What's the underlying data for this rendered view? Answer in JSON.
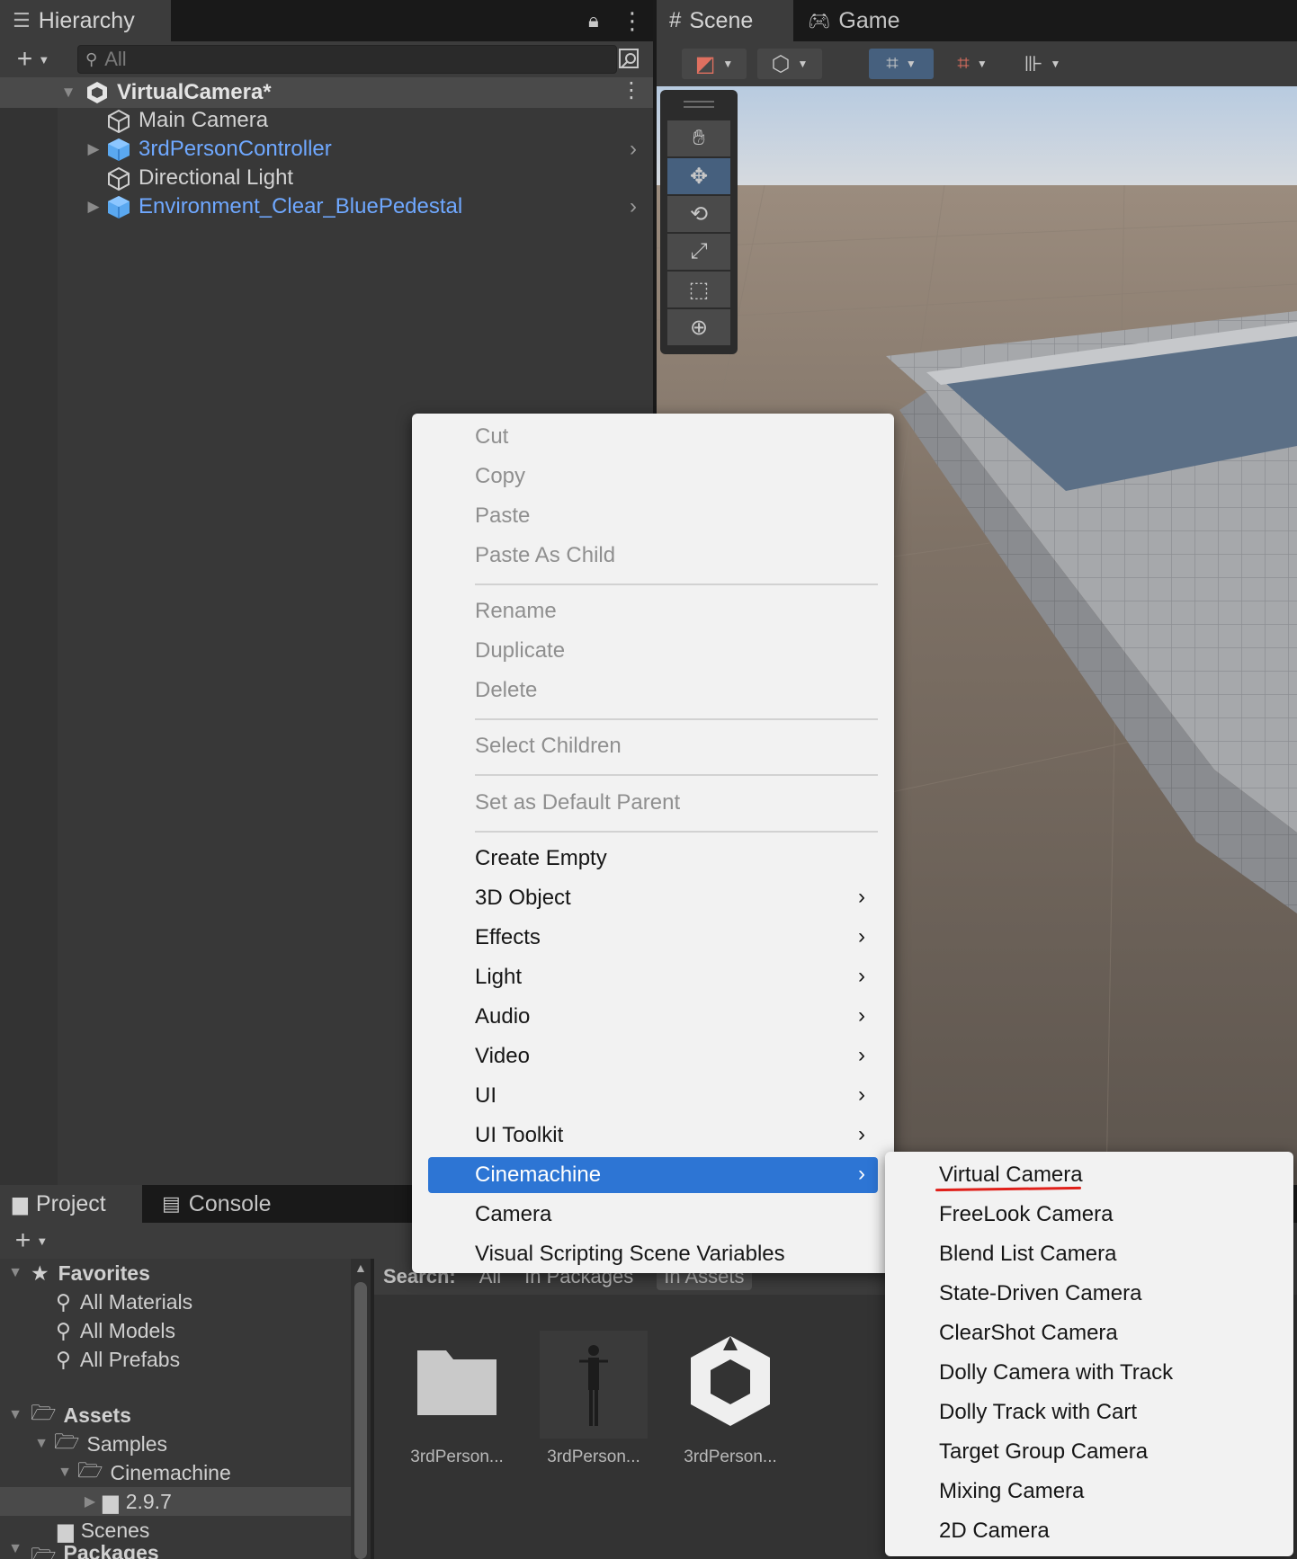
{
  "hierarchy": {
    "tab_label": "Hierarchy",
    "search_placeholder": "All",
    "scene_name": "VirtualCamera*",
    "items": [
      {
        "label": "Main Camera"
      },
      {
        "label": "3rdPersonController"
      },
      {
        "label": "Directional Light"
      },
      {
        "label": "Environment_Clear_BluePedestal"
      }
    ]
  },
  "scene_view": {
    "tabs": [
      {
        "label": "Scene"
      },
      {
        "label": "Game"
      }
    ]
  },
  "context_menu": {
    "disabled_items": [
      "Cut",
      "Copy",
      "Paste",
      "Paste As Child",
      "Rename",
      "Duplicate",
      "Delete",
      "Select Children",
      "Set as Default Parent"
    ],
    "items": [
      {
        "label": "Create Empty"
      },
      {
        "label": "3D Object"
      },
      {
        "label": "Effects"
      },
      {
        "label": "Light"
      },
      {
        "label": "Audio"
      },
      {
        "label": "Video"
      },
      {
        "label": "UI"
      },
      {
        "label": "UI Toolkit"
      },
      {
        "label": "Cinemachine"
      },
      {
        "label": "Camera"
      },
      {
        "label": "Visual Scripting Scene Variables"
      }
    ],
    "submenu_arrow": "›"
  },
  "cinemachine_submenu": {
    "items": [
      "Virtual Camera",
      "FreeLook Camera",
      "Blend List Camera",
      "State-Driven Camera",
      "ClearShot Camera",
      "Dolly Camera with Track",
      "Dolly Track with Cart",
      "Target Group Camera",
      "Mixing Camera",
      "2D Camera"
    ],
    "underline_color": "#e0201a"
  },
  "project": {
    "tabs": [
      {
        "label": "Project"
      },
      {
        "label": "Console"
      }
    ],
    "favorites": {
      "label": "Favorites",
      "items": [
        "All Materials",
        "All Models",
        "All Prefabs"
      ]
    },
    "assets": {
      "label": "Assets",
      "samples": "Samples",
      "cinemachine": "Cinemachine",
      "version": "2.9.7",
      "scenes": "Scenes"
    },
    "packages": "Packages",
    "search_bar": {
      "search": "Search:",
      "all": "All",
      "in_packages": "In Packages",
      "in_assets": "In Assets"
    },
    "asset_items": [
      "3rdPerson...",
      "3rdPerson...",
      "3rdPerson..."
    ]
  },
  "colors": {
    "selection": "#2d75d4",
    "prefab_blue": "#6fa8ff",
    "menu_bg": "#f2f2f2"
  }
}
